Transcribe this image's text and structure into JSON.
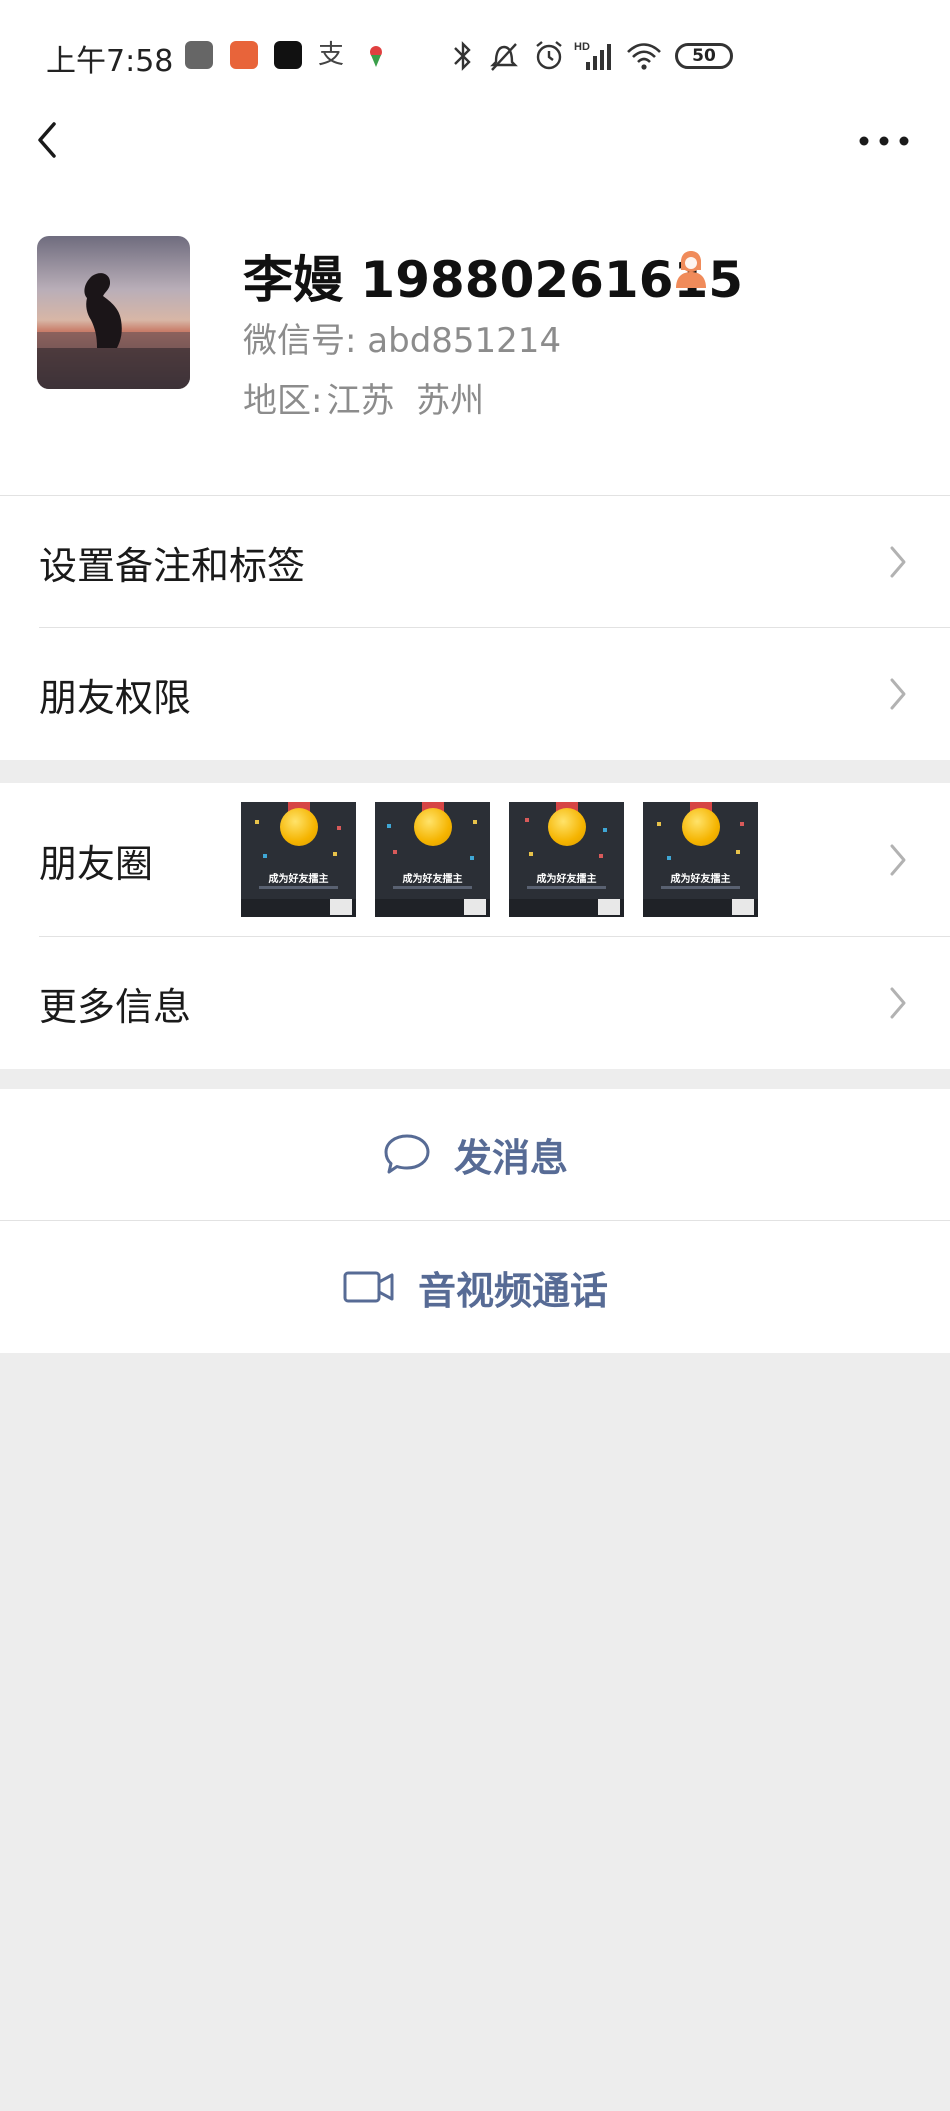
{
  "status_bar": {
    "time": "上午7:58",
    "battery": "50",
    "network": "HD"
  },
  "nav": {
    "back_icon": "chevron-left-icon",
    "more_icon": "more-dots-icon"
  },
  "profile": {
    "name": "李嫚 19880261615",
    "wechat_id_label": "微信号:",
    "wechat_id": "abd851214",
    "region_label": "地区:",
    "region": "江苏  苏州",
    "gender_icon": "female-icon"
  },
  "menu": {
    "remark": "设置备注和标签",
    "permissions": "朋友权限",
    "moments": "朋友圈",
    "more_info": "更多信息"
  },
  "moments_thumbs": {
    "title": "成为好友擂主",
    "count": 4
  },
  "actions": {
    "send_message": "发消息",
    "video_call": "音视频通话"
  },
  "colors": {
    "link_blue": "#576b95",
    "gender_orange": "#f08b5a",
    "background": "#ededed"
  }
}
